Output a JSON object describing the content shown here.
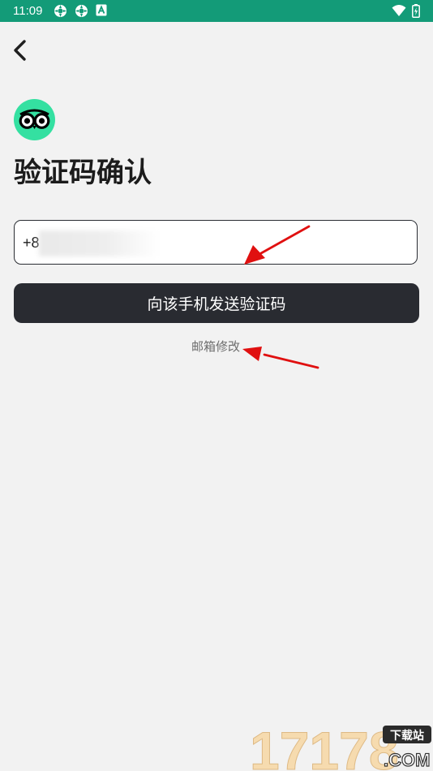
{
  "status_bar": {
    "time": "11:09",
    "background": "#139b78",
    "icons": [
      "notification-icon",
      "notification-icon",
      "app-notification-icon",
      "wifi-icon",
      "battery-icon"
    ]
  },
  "nav": {
    "back_icon": "back-chevron-icon"
  },
  "logo": {
    "icon": "owl-eyes-logo",
    "color": "#34e0a1"
  },
  "page": {
    "title": "验证码确认"
  },
  "phone_input": {
    "value": "+8"
  },
  "send_button": {
    "label": "向该手机发送验证码",
    "background": "#292b31"
  },
  "email_link": {
    "label": "邮箱修改"
  },
  "annotations": {
    "arrow_color": "#e01010"
  },
  "watermark": {
    "number": "17178",
    "tag": "下载站",
    "domain": ".COM"
  }
}
